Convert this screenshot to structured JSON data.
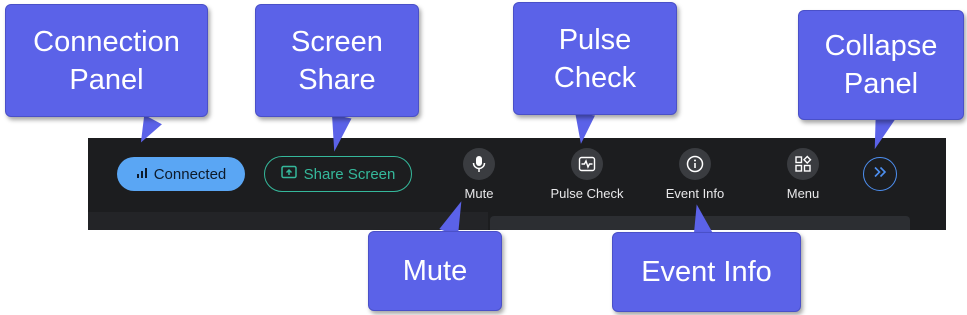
{
  "toolbar": {
    "connected_label": "Connected",
    "share_label": "Share Screen",
    "tools": [
      {
        "label": "Mute",
        "icon": "microphone-icon"
      },
      {
        "label": "Pulse Check",
        "icon": "pulse-check-icon"
      },
      {
        "label": "Event Info",
        "icon": "info-icon"
      },
      {
        "label": "Menu",
        "icon": "apps-menu-icon"
      }
    ],
    "collapse_icon": "double-chevron-right-icon"
  },
  "callouts": {
    "connection_panel": "Connection\nPanel",
    "screen_share": "Screen\nShare",
    "pulse_check": "Pulse\nCheck",
    "collapse_panel": "Collapse\nPanel",
    "mute": "Mute",
    "event_info": "Event Info"
  },
  "colors": {
    "callout": "#5b62e8",
    "toolbar": "#1c1d1f",
    "connected": "#5aa6f4",
    "share": "#35b89b",
    "collapse": "#4d8ff0"
  }
}
